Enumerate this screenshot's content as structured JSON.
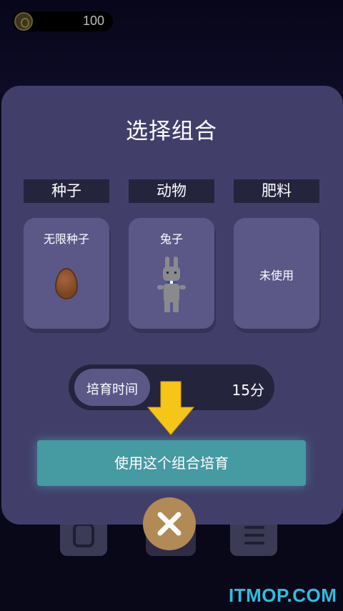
{
  "hud": {
    "coin_icon": "coin-icon",
    "coins": "100"
  },
  "dialog": {
    "title": "选择组合",
    "columns": [
      {
        "header": "种子",
        "item": "无限种子",
        "icon": "egg-seed-icon"
      },
      {
        "header": "动物",
        "item": "兔子",
        "icon": "rabbit-icon"
      },
      {
        "header": "肥料",
        "item": "未使用",
        "icon": ""
      }
    ],
    "timer": {
      "label": "培育时间",
      "value": "15分"
    },
    "action_label": "使用这个组合培育",
    "close_icon": "close-icon"
  },
  "watermark": "ITMOP.COM",
  "colors": {
    "dialog_bg": "#413f6a",
    "card_bg": "#5b5888",
    "header_bg": "#25243d",
    "action_bg": "#469aa2",
    "close_bg": "#b28a55",
    "arrow": "#f5c518"
  }
}
